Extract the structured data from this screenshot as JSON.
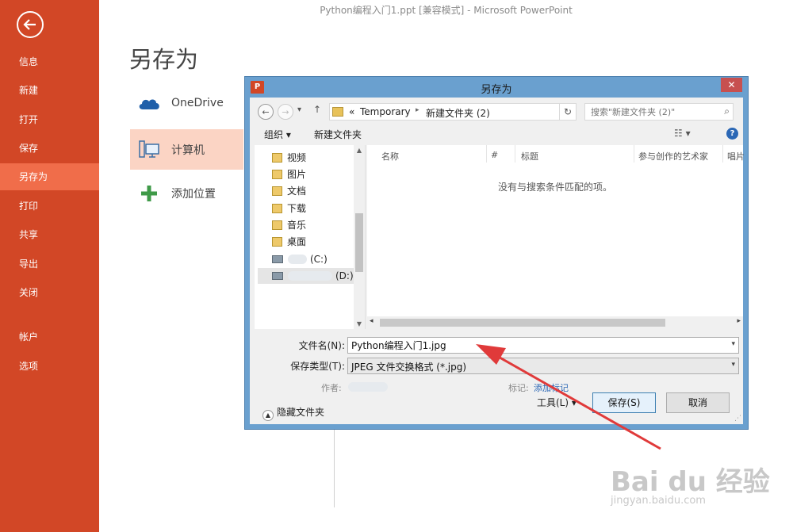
{
  "window": {
    "title": "Python编程入门1.ppt [兼容模式] - Microsoft PowerPoint"
  },
  "backstage": {
    "heading": "另存为",
    "menu": [
      "信息",
      "新建",
      "打开",
      "保存",
      "另存为",
      "打印",
      "共享",
      "导出",
      "关闭",
      "帐户",
      "选项"
    ],
    "active_item": "另存为",
    "places": [
      {
        "label": "OneDrive",
        "icon": "cloud-icon"
      },
      {
        "label": "计算机",
        "icon": "computer-icon",
        "selected": true
      },
      {
        "label": "添加位置",
        "icon": "plus-icon"
      }
    ]
  },
  "dialog": {
    "title": "另存为",
    "app_badge": "P",
    "close_label": "✕",
    "breadcrumb": {
      "prefix": "«",
      "items": [
        "Temporary",
        "新建文件夹 (2)"
      ]
    },
    "search_placeholder": "搜索\"新建文件夹 (2)\"",
    "toolbar": {
      "organize": "组织 ▾",
      "new_folder": "新建文件夹",
      "help": "?"
    },
    "nav_items": [
      {
        "label": "视频"
      },
      {
        "label": "图片"
      },
      {
        "label": "文档"
      },
      {
        "label": "下载"
      },
      {
        "label": "音乐"
      },
      {
        "label": "桌面"
      },
      {
        "label": "(C:)"
      },
      {
        "label": "(D:)"
      }
    ],
    "columns": [
      "名称",
      "#",
      "标题",
      "参与创作的艺术家",
      "唱片"
    ],
    "empty_message": "没有与搜索条件匹配的项。",
    "filename_label": "文件名(N):",
    "filename_value": "Python编程入门1.jpg",
    "filetype_label": "保存类型(T):",
    "filetype_value": "JPEG 文件交换格式 (*.jpg)",
    "author_label": "作者:",
    "tags_label": "标记:",
    "tags_link": "添加标记",
    "hide_folders": "隐藏文件夹",
    "tools": "工具(L)",
    "save": "保存(S)",
    "cancel": "取消"
  },
  "watermark": {
    "brand": "Bai du 经验",
    "url": "jingyan.baidu.com"
  },
  "colors": {
    "sidebar": "#d24726",
    "sidebar_active": "#f06d4a",
    "arrow": "#e03a3a",
    "dialog_frame": "#6aa0cf"
  }
}
